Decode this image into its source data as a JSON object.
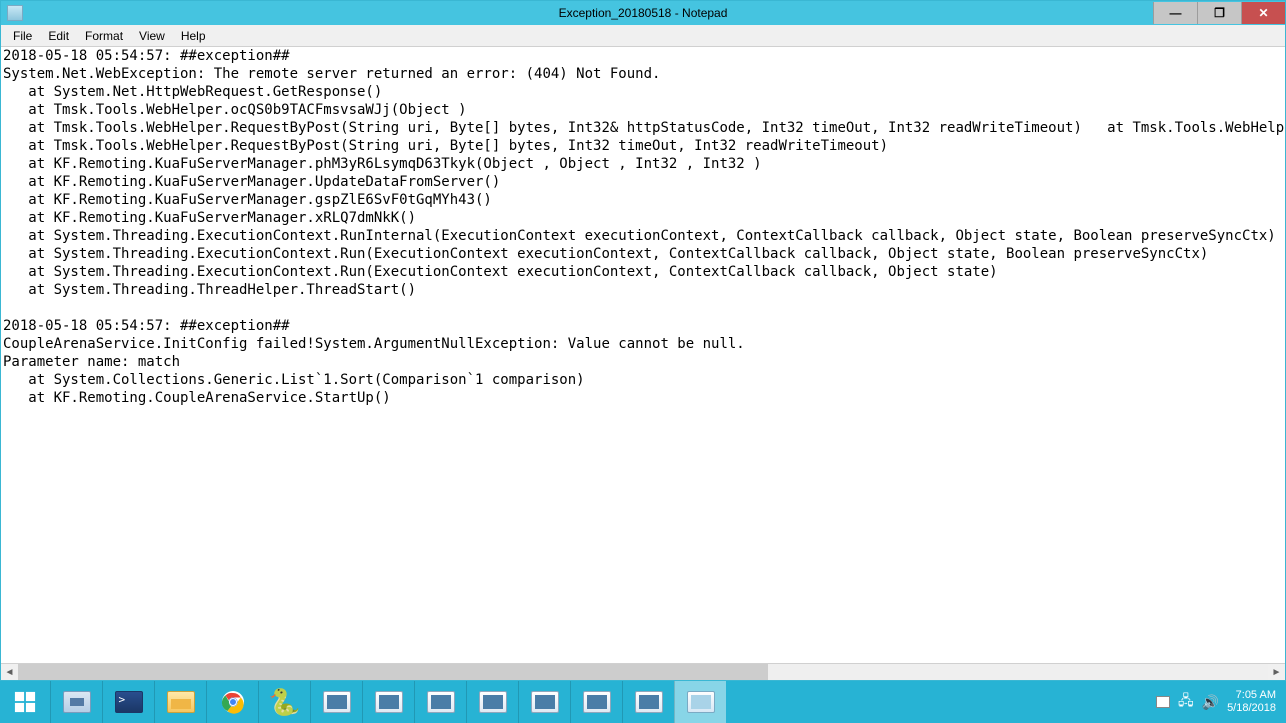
{
  "window": {
    "title": "Exception_20180518 - Notepad"
  },
  "menu": {
    "file": "File",
    "edit": "Edit",
    "format": "Format",
    "view": "View",
    "help": "Help"
  },
  "content": "2018-05-18 05:54:57: ##exception##\nSystem.Net.WebException: The remote server returned an error: (404) Not Found.\n   at System.Net.HttpWebRequest.GetResponse()\n   at Tmsk.Tools.WebHelper.ocQS0b9TACFmsvsaWJj(Object )\n   at Tmsk.Tools.WebHelper.RequestByPost(String uri, Byte[] bytes, Int32& httpStatusCode, Int32 timeOut, Int32 readWriteTimeout)   at Tmsk.Tools.WebHelper.Re\n   at Tmsk.Tools.WebHelper.RequestByPost(String uri, Byte[] bytes, Int32 timeOut, Int32 readWriteTimeout)\n   at KF.Remoting.KuaFuServerManager.phM3yR6LsymqD63Tkyk(Object , Object , Int32 , Int32 )\n   at KF.Remoting.KuaFuServerManager.UpdateDataFromServer()\n   at KF.Remoting.KuaFuServerManager.gspZlE6SvF0tGqMYh43()\n   at KF.Remoting.KuaFuServerManager.xRLQ7dmNkK()\n   at System.Threading.ExecutionContext.RunInternal(ExecutionContext executionContext, ContextCallback callback, Object state, Boolean preserveSyncCtx)\n   at System.Threading.ExecutionContext.Run(ExecutionContext executionContext, ContextCallback callback, Object state, Boolean preserveSyncCtx)\n   at System.Threading.ExecutionContext.Run(ExecutionContext executionContext, ContextCallback callback, Object state)\n   at System.Threading.ThreadHelper.ThreadStart()\n\n2018-05-18 05:54:57: ##exception##\nCoupleArenaService.InitConfig failed!System.ArgumentNullException: Value cannot be null.\nParameter name: match\n   at System.Collections.Generic.List`1.Sort(Comparison`1 comparison)\n   at KF.Remoting.CoupleArenaService.StartUp()\n",
  "win_controls": {
    "minimize": "—",
    "maximize": "❐",
    "close": "✕"
  },
  "clock": {
    "time": "7:05 AM",
    "date": "5/18/2018"
  }
}
